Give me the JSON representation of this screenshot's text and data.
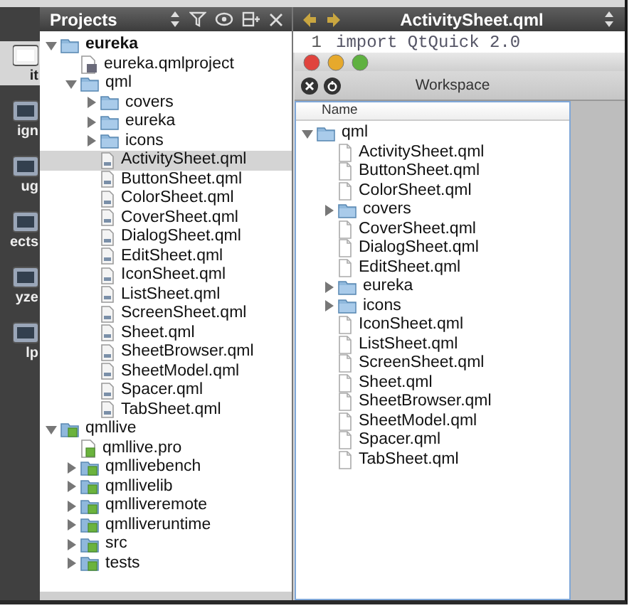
{
  "modes": [
    {
      "label": "it",
      "selected": true
    },
    {
      "label": "ign",
      "selected": false
    },
    {
      "label": "ug",
      "selected": false
    },
    {
      "label": "ects",
      "selected": false
    },
    {
      "label": "yze",
      "selected": false
    },
    {
      "label": "lp",
      "selected": false
    }
  ],
  "projects": {
    "title": "Projects",
    "tree": [
      {
        "label": "eureka",
        "kind": "folder",
        "current": true,
        "expanded": true,
        "selected": false,
        "children": [
          {
            "label": "eureka.qmlproject",
            "kind": "project-file",
            "selected": false
          },
          {
            "label": "qml",
            "kind": "folder",
            "expanded": true,
            "selected": false,
            "children": [
              {
                "label": "covers",
                "kind": "folder",
                "expanded": false,
                "selected": false
              },
              {
                "label": "eureka",
                "kind": "folder",
                "expanded": false,
                "selected": false
              },
              {
                "label": "icons",
                "kind": "folder",
                "expanded": false,
                "selected": false
              },
              {
                "label": "ActivitySheet.qml",
                "kind": "qml-file",
                "selected": true
              },
              {
                "label": "ButtonSheet.qml",
                "kind": "qml-file",
                "selected": false
              },
              {
                "label": "ColorSheet.qml",
                "kind": "qml-file",
                "selected": false
              },
              {
                "label": "CoverSheet.qml",
                "kind": "qml-file",
                "selected": false
              },
              {
                "label": "DialogSheet.qml",
                "kind": "qml-file",
                "selected": false
              },
              {
                "label": "EditSheet.qml",
                "kind": "qml-file",
                "selected": false
              },
              {
                "label": "IconSheet.qml",
                "kind": "qml-file",
                "selected": false
              },
              {
                "label": "ListSheet.qml",
                "kind": "qml-file",
                "selected": false
              },
              {
                "label": "ScreenSheet.qml",
                "kind": "qml-file",
                "selected": false
              },
              {
                "label": "Sheet.qml",
                "kind": "qml-file",
                "selected": false
              },
              {
                "label": "SheetBrowser.qml",
                "kind": "qml-file",
                "selected": false
              },
              {
                "label": "SheetModel.qml",
                "kind": "qml-file",
                "selected": false
              },
              {
                "label": "Spacer.qml",
                "kind": "qml-file",
                "selected": false
              },
              {
                "label": "TabSheet.qml",
                "kind": "qml-file",
                "selected": false
              }
            ]
          }
        ]
      },
      {
        "label": "qmllive",
        "kind": "qt-folder",
        "current": false,
        "expanded": true,
        "selected": false,
        "children": [
          {
            "label": "qmllive.pro",
            "kind": "qt-file",
            "selected": false
          },
          {
            "label": "qmllivebench",
            "kind": "qt-folder",
            "expanded": false,
            "selected": false
          },
          {
            "label": "qmllivelib",
            "kind": "qt-folder",
            "expanded": false,
            "selected": false
          },
          {
            "label": "qmlliveremote",
            "kind": "qt-folder",
            "expanded": false,
            "selected": false
          },
          {
            "label": "qmlliveruntime",
            "kind": "qt-folder",
            "expanded": false,
            "selected": false
          },
          {
            "label": "src",
            "kind": "qt-folder",
            "expanded": false,
            "selected": false
          },
          {
            "label": "tests",
            "kind": "qt-folder",
            "expanded": false,
            "selected": false
          }
        ]
      }
    ]
  },
  "editor": {
    "title": "ActivitySheet.qml",
    "line_number": "1",
    "code": "import QtQuick 2.0"
  },
  "workspace": {
    "title": "Workspace",
    "column": "Name",
    "tree": [
      {
        "label": "qml",
        "kind": "folder",
        "expanded": true,
        "children": [
          {
            "label": "ActivitySheet.qml",
            "kind": "file"
          },
          {
            "label": "ButtonSheet.qml",
            "kind": "file"
          },
          {
            "label": "ColorSheet.qml",
            "kind": "file"
          },
          {
            "label": "covers",
            "kind": "folder",
            "expanded": false
          },
          {
            "label": "CoverSheet.qml",
            "kind": "file"
          },
          {
            "label": "DialogSheet.qml",
            "kind": "file"
          },
          {
            "label": "EditSheet.qml",
            "kind": "file"
          },
          {
            "label": "eureka",
            "kind": "folder",
            "expanded": false
          },
          {
            "label": "icons",
            "kind": "folder",
            "expanded": false
          },
          {
            "label": "IconSheet.qml",
            "kind": "file"
          },
          {
            "label": "ListSheet.qml",
            "kind": "file"
          },
          {
            "label": "ScreenSheet.qml",
            "kind": "file"
          },
          {
            "label": "Sheet.qml",
            "kind": "file"
          },
          {
            "label": "SheetBrowser.qml",
            "kind": "file"
          },
          {
            "label": "SheetModel.qml",
            "kind": "file"
          },
          {
            "label": "Spacer.qml",
            "kind": "file"
          },
          {
            "label": "TabSheet.qml",
            "kind": "file"
          }
        ]
      }
    ]
  }
}
